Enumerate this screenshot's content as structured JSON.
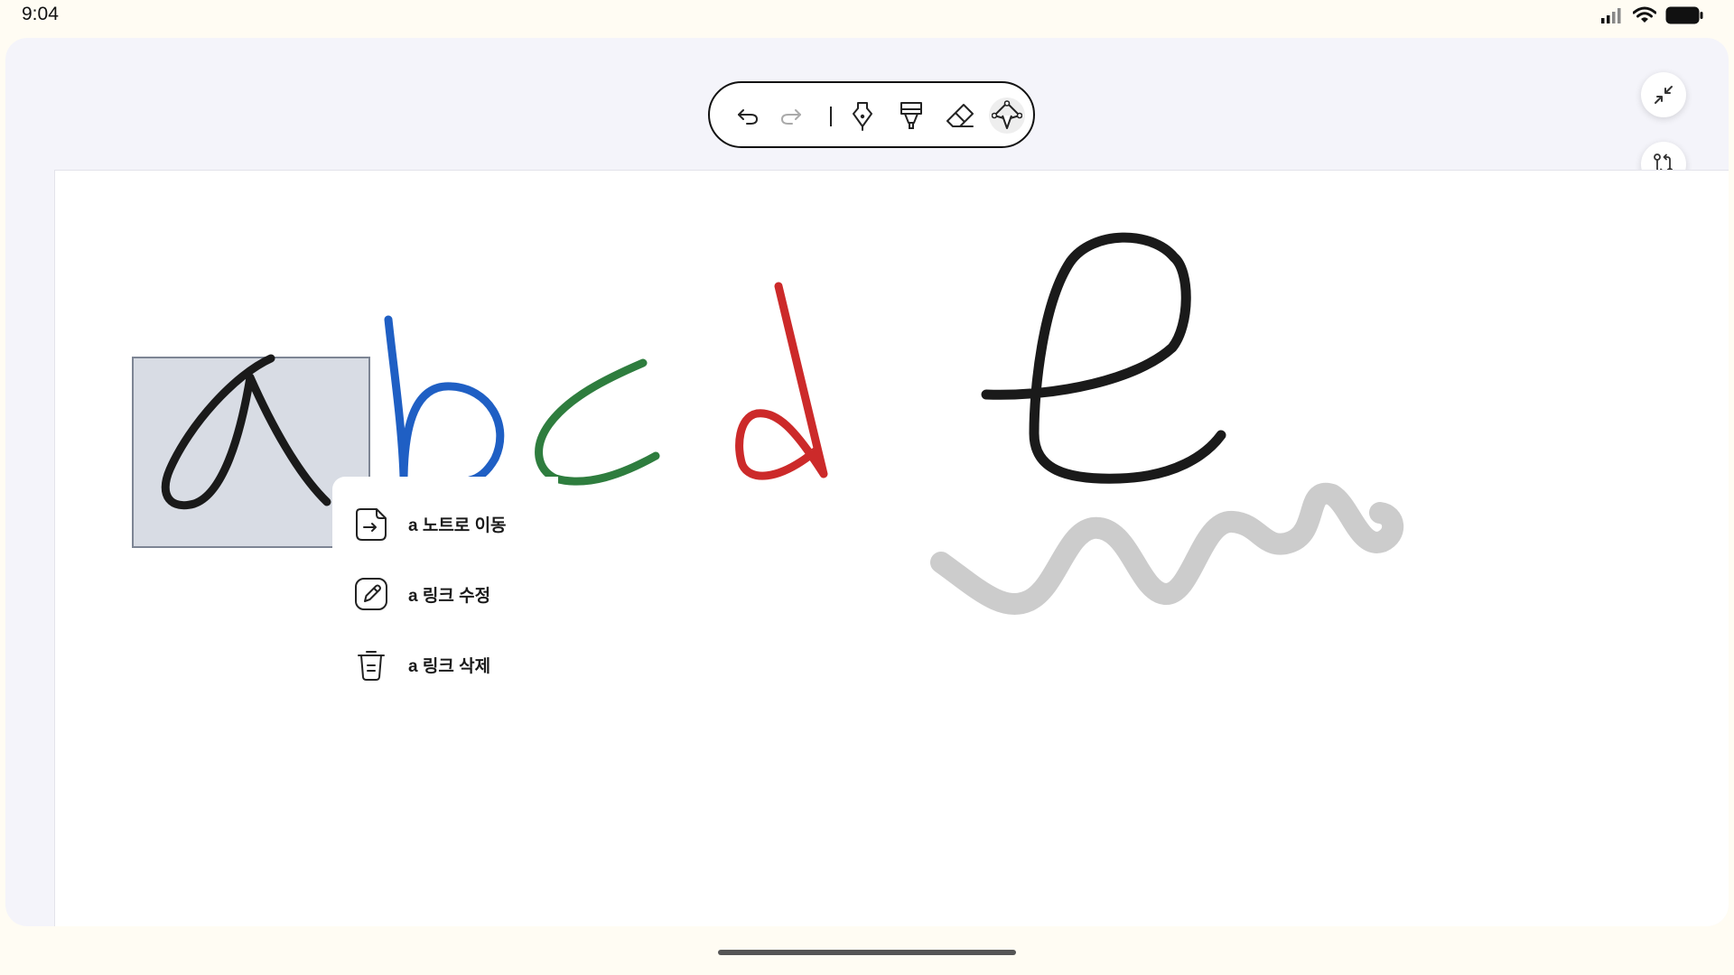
{
  "status_bar": {
    "time": "9:04",
    "icons": [
      "signal-icon",
      "wifi-icon",
      "battery-icon"
    ]
  },
  "toolbar": {
    "tools": [
      "undo-icon",
      "redo-icon",
      "pen-icon",
      "highlighter-icon",
      "eraser-icon",
      "lasso-icon"
    ]
  },
  "side_buttons": [
    "collapse-icon",
    "swap-icon",
    "book-icon"
  ],
  "canvas": {
    "stroke_colors": {
      "black": "#1a1a1a",
      "blue": "#1f5fc4",
      "green": "#2e7d3e",
      "red": "#cc2a2a",
      "gray": "#cccccc"
    }
  },
  "context_menu": {
    "items": [
      {
        "label": "a 노트로 이동",
        "icon": "move-to-note-icon"
      },
      {
        "label": "a 링크 수정",
        "icon": "edit-link-icon"
      },
      {
        "label": "a 링크 삭제",
        "icon": "delete-icon"
      }
    ]
  }
}
